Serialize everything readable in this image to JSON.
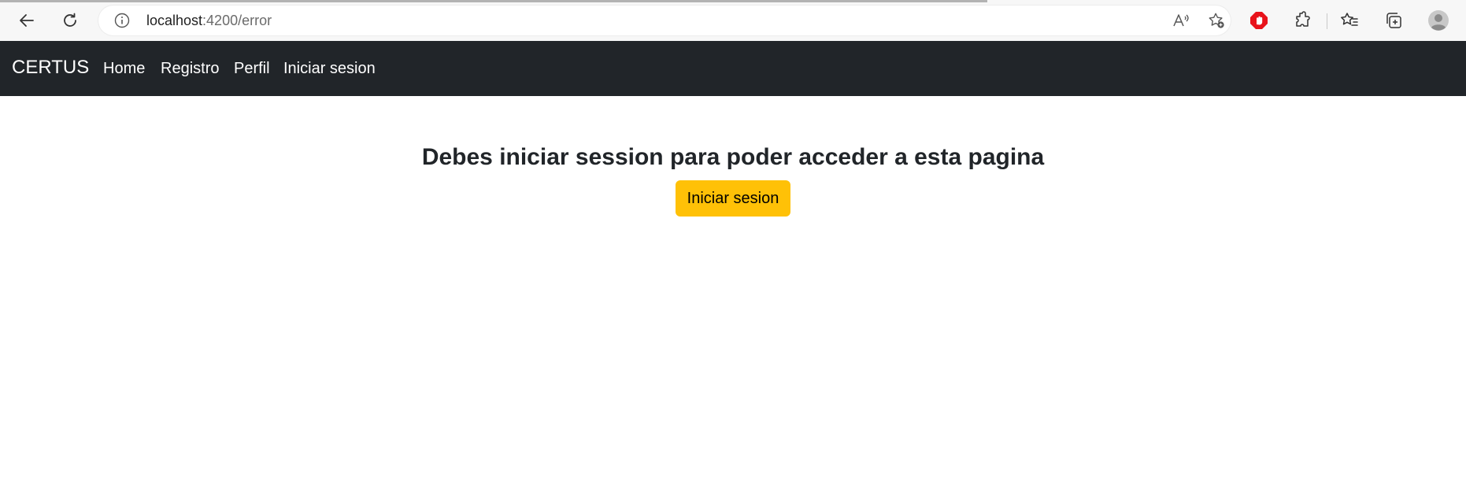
{
  "browser": {
    "url_host": "localhost",
    "url_path": ":4200/error",
    "icons": [
      "back-arrow-icon",
      "reload-icon",
      "info-icon",
      "read-aloud-icon",
      "add-favorite-icon",
      "adblock-icon",
      "extensions-icon",
      "favorites-icon",
      "collections-icon",
      "profile-avatar-icon"
    ]
  },
  "navbar": {
    "brand": "CERTUS",
    "links": [
      "Home",
      "Registro",
      "Perfil",
      "Iniciar sesion"
    ],
    "background": "#212529"
  },
  "main": {
    "title": "Debes iniciar session para poder acceder a esta pagina",
    "button_label": "Iniciar sesion",
    "button_color": "#ffc107"
  }
}
